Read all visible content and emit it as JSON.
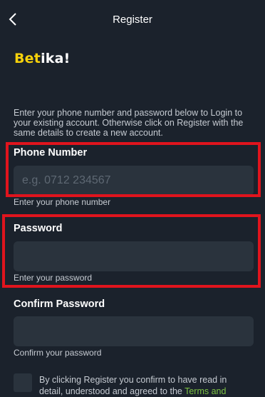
{
  "header": {
    "title": "Register",
    "back_icon": "chevron-left-icon"
  },
  "logo": {
    "part1": "Bet",
    "part2": "ika!"
  },
  "intro": {
    "text": "Enter your phone number and password below to Login to your existing account. Otherwise click on Register with the same details to create a new account."
  },
  "phone": {
    "label": "Phone Number",
    "placeholder": "e.g. 0712 234567",
    "value": "",
    "help": "Enter your phone number"
  },
  "password": {
    "label": "Password",
    "placeholder": "",
    "value": "",
    "help": "Enter your password"
  },
  "confirm_password": {
    "label": "Confirm Password",
    "placeholder": "",
    "value": "",
    "help": "Confirm your password"
  },
  "terms": {
    "text_before": "By clicking Register you confirm to have read in detail, understood and agreed to the ",
    "link_text": "Terms and"
  },
  "colors": {
    "background": "#1b222c",
    "input_bg": "#2a333d",
    "highlight": "#e0141d",
    "link": "#7cc143",
    "brand_yellow": "#f6d10b"
  }
}
